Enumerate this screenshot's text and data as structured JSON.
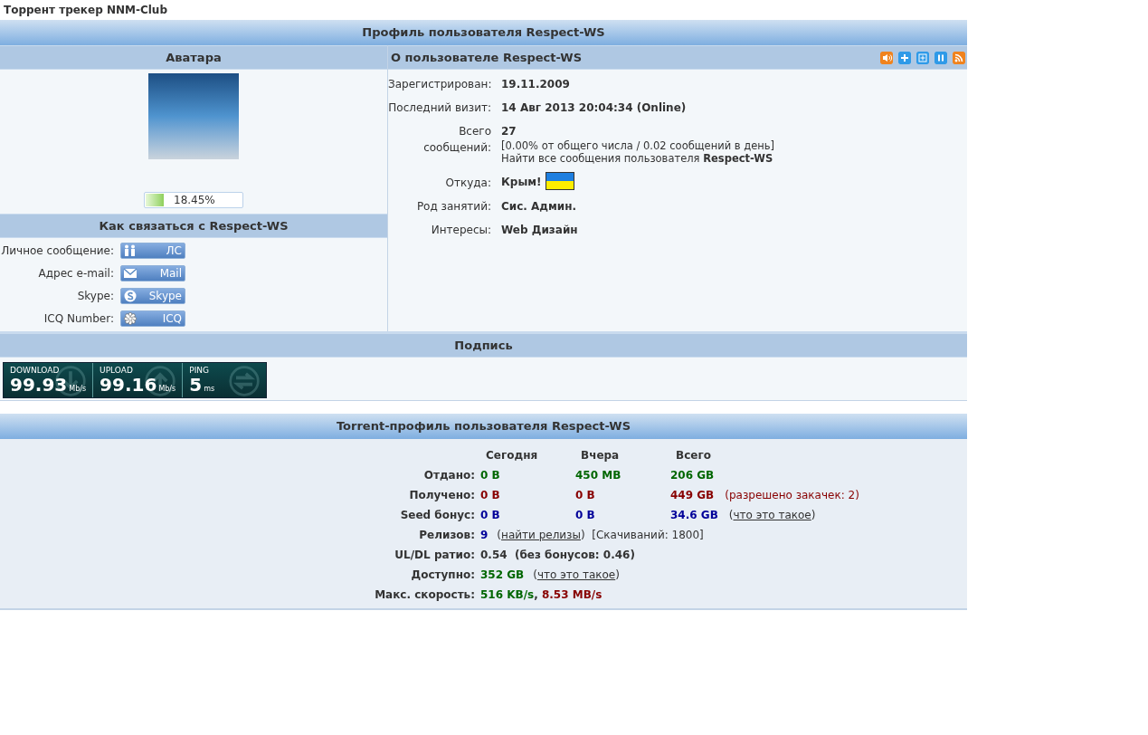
{
  "site_title": "Торрент трекер NNM-Club",
  "profile": {
    "header": "Профиль пользователя Respect-WS",
    "avatar_heading": "Аватара",
    "rating": {
      "level": 0.1845,
      "reading": "18.45%"
    },
    "contact_heading": "Как связаться с Respect-WS",
    "contacts": [
      {
        "label": "Личное сообщение:",
        "button": "ЛС",
        "kind": "pm"
      },
      {
        "label": "Адрес e-mail:",
        "button": "Mail",
        "kind": "mail"
      },
      {
        "label": "Skype:",
        "button": "Skype",
        "kind": "skype"
      },
      {
        "label": "ICQ Number:",
        "button": "ICQ",
        "kind": "icq"
      }
    ],
    "about_heading": "О пользователе Respect-WS",
    "fields": [
      {
        "label": "Зарегистрирован:",
        "kind": "text",
        "value": "19.11.2009"
      },
      {
        "label": "Последний визит:",
        "kind": "text",
        "value": "14 Авг 2013 20:04:34 (Online)"
      },
      {
        "label": "Всего сообщений:",
        "kind": "text",
        "value": "27",
        "lines": [
          "[0.00% от общего числа / 0.02 сообщений в день]",
          "Найти все сообщения пользователя **Respect-WS**"
        ]
      },
      {
        "label": "Откуда:",
        "kind": "location",
        "value": "Крым!"
      },
      {
        "label": "Род занятий:",
        "kind": "text",
        "value": "Сис. Админ."
      },
      {
        "label": "Интересы:",
        "kind": "text",
        "value": "Web Дизайн"
      }
    ]
  },
  "signature": {
    "heading": "Подпись",
    "speedtest": [
      {
        "label": "DOWNLOAD",
        "value": "99.93",
        "unit": "Mb/s",
        "kind": "down"
      },
      {
        "label": "UPLOAD",
        "value": "99.16",
        "unit": "Mb/s",
        "kind": "up"
      },
      {
        "label": "PING",
        "value": "5",
        "unit": "ms",
        "kind": "ping"
      }
    ]
  },
  "torrent": {
    "heading": "Torrent-профиль пользователя Respect-WS",
    "columns": [
      "Сегодня",
      "Вчера",
      "Всего"
    ],
    "rows": [
      {
        "label": "Отдано:",
        "kind": "grid",
        "values": [
          {
            "text": "0 B",
            "color": "#006600"
          },
          {
            "text": "450 MB",
            "color": "#006600"
          },
          {
            "text": "206 GB",
            "color": "#006600"
          }
        ]
      },
      {
        "label": "Получено:",
        "kind": "grid",
        "values": [
          {
            "text": "0 B",
            "color": "#880000"
          },
          {
            "text": "0 B",
            "color": "#880000"
          },
          {
            "text": "449 GB",
            "color": "#880000"
          }
        ],
        "note": {
          "color": "#880000",
          "parts": [
            {
              "kind": "text",
              "text": "(разрешено закачек: 2)"
            }
          ]
        }
      },
      {
        "label": "Seed бонус:",
        "kind": "grid",
        "values": [
          {
            "text": "0 B",
            "color": "#000099"
          },
          {
            "text": "0 B",
            "color": "#000099"
          },
          {
            "text": "34.6 GB",
            "color": "#000099"
          }
        ],
        "note": {
          "color": "#333333",
          "parts": [
            {
              "kind": "text",
              "text": "("
            },
            {
              "kind": "link",
              "text": "что это такое"
            },
            {
              "kind": "text",
              "text": ")"
            }
          ]
        }
      },
      {
        "label": "Релизов:",
        "kind": "inline",
        "values": [
          {
            "text": "9",
            "color": "#000099"
          }
        ],
        "note": {
          "color": "#333333",
          "parts": [
            {
              "kind": "text",
              "text": "("
            },
            {
              "kind": "link",
              "text": "найти релизы"
            },
            {
              "kind": "text",
              "text": ")  [Скачиваний: 1800]"
            }
          ]
        }
      },
      {
        "label": "UL/DL ратио:",
        "kind": "inline",
        "values": [
          {
            "text": "0.54  (без бонусов: 0.46)",
            "color": "#333333"
          }
        ]
      },
      {
        "label": "Доступно:",
        "kind": "inline",
        "values": [
          {
            "text": "352 GB",
            "color": "#006600"
          }
        ],
        "note": {
          "color": "#333333",
          "parts": [
            {
              "kind": "text",
              "text": "("
            },
            {
              "kind": "link",
              "text": "что это такое"
            },
            {
              "kind": "text",
              "text": ")"
            }
          ]
        }
      },
      {
        "label": "Макс. скорость:",
        "kind": "inline",
        "values": [
          {
            "text": "516 KB/s",
            "color": "#006600"
          },
          {
            "text": ", ",
            "color": "#333333"
          },
          {
            "text": "8.53 MB/s",
            "color": "#880000"
          }
        ]
      }
    ]
  }
}
